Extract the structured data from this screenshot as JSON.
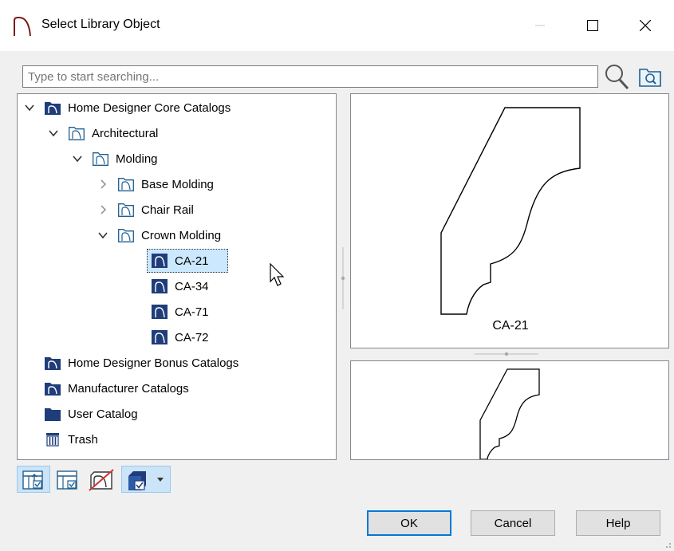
{
  "window": {
    "title": "Select Library Object"
  },
  "search": {
    "placeholder": "Type to start searching..."
  },
  "tree": [
    {
      "label": "Home Designer Core Catalogs",
      "icon": "catalog-folder-icon",
      "expanded": true,
      "level": 0
    },
    {
      "label": "Architectural",
      "icon": "folder-outline-icon",
      "expanded": true,
      "level": 1
    },
    {
      "label": "Molding",
      "icon": "folder-outline-icon",
      "expanded": true,
      "level": 2
    },
    {
      "label": "Base Molding",
      "icon": "folder-outline-icon",
      "expanded": false,
      "level": 3
    },
    {
      "label": "Chair Rail",
      "icon": "folder-outline-icon",
      "expanded": false,
      "level": 3
    },
    {
      "label": "Crown Molding",
      "icon": "folder-outline-icon",
      "expanded": true,
      "level": 3
    },
    {
      "label": "CA-21",
      "icon": "molding-item-icon",
      "selected": true,
      "level": 4
    },
    {
      "label": "CA-34",
      "icon": "molding-item-icon",
      "level": 4
    },
    {
      "label": "CA-71",
      "icon": "molding-item-icon",
      "level": 4
    },
    {
      "label": "CA-72",
      "icon": "molding-item-icon",
      "level": 4
    },
    {
      "label": "Home Designer Bonus Catalogs",
      "icon": "catalog-folder-icon",
      "level": 0
    },
    {
      "label": "Manufacturer Catalogs",
      "icon": "catalog-folder-icon",
      "level": 0
    },
    {
      "label": "User Catalog",
      "icon": "folder-filled-icon",
      "level": 0
    },
    {
      "label": "Trash",
      "icon": "trash-icon",
      "level": 0
    }
  ],
  "preview": {
    "label": "CA-21"
  },
  "buttons": {
    "ok": "OK",
    "cancel": "Cancel",
    "help": "Help"
  },
  "colors": {
    "selection": "#cce8ff",
    "catalog_icon": "#1f3d7a",
    "default_button_border": "#0078d7"
  }
}
